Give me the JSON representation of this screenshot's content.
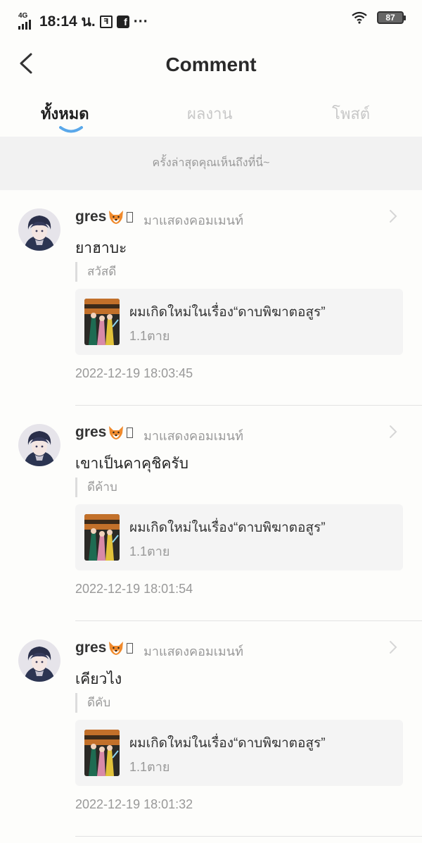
{
  "status_bar": {
    "network": "4G",
    "time": "18:14 น.",
    "sim_icon_glyph": "ꟻ",
    "facebook_glyph": "f",
    "more": "···",
    "battery": "87",
    "icons": [
      "signal-icon",
      "sim-icon",
      "facebook-icon",
      "wifi-icon",
      "battery-icon"
    ]
  },
  "header": {
    "title": "Comment",
    "back_icon": "chevron-left-icon"
  },
  "tabs": [
    {
      "label": "ทั้งหมด",
      "active": true
    },
    {
      "label": "ผลงาน",
      "active": false
    },
    {
      "label": "โพสต์",
      "active": false
    }
  ],
  "notice": "ครั้งล่าสุดคุณเห็นถึงที่นี่~",
  "colors": {
    "accent": "#5aa8ea",
    "notice_bg": "#f2f2f2",
    "card_bg": "#f4f4f4"
  },
  "comments": [
    {
      "username": "gres",
      "action": "มาแสดงคอมเมนท์",
      "text": "ยาฮาบะ",
      "quote": "สวัสดี",
      "work_title": "ผมเกิดใหม่ในเรื่อง“ดาบพิฆาตอสูร”",
      "chapter": "1.1ตาย",
      "time": "2022-12-19 18:03:45"
    },
    {
      "username": "gres",
      "action": "มาแสดงคอมเมนท์",
      "text": "เขาเป็นคาคุชิครับ",
      "quote": "ดีค้าบ",
      "work_title": "ผมเกิดใหม่ในเรื่อง“ดาบพิฆาตอสูร”",
      "chapter": "1.1ตาย",
      "time": "2022-12-19 18:01:54"
    },
    {
      "username": "gres",
      "action": "มาแสดงคอมเมนท์",
      "text": "เคียวไง",
      "quote": "ดีคับ",
      "work_title": "ผมเกิดใหม่ในเรื่อง“ดาบพิฆาตอสูร”",
      "chapter": "1.1ตาย",
      "time": "2022-12-19 18:01:32"
    }
  ]
}
